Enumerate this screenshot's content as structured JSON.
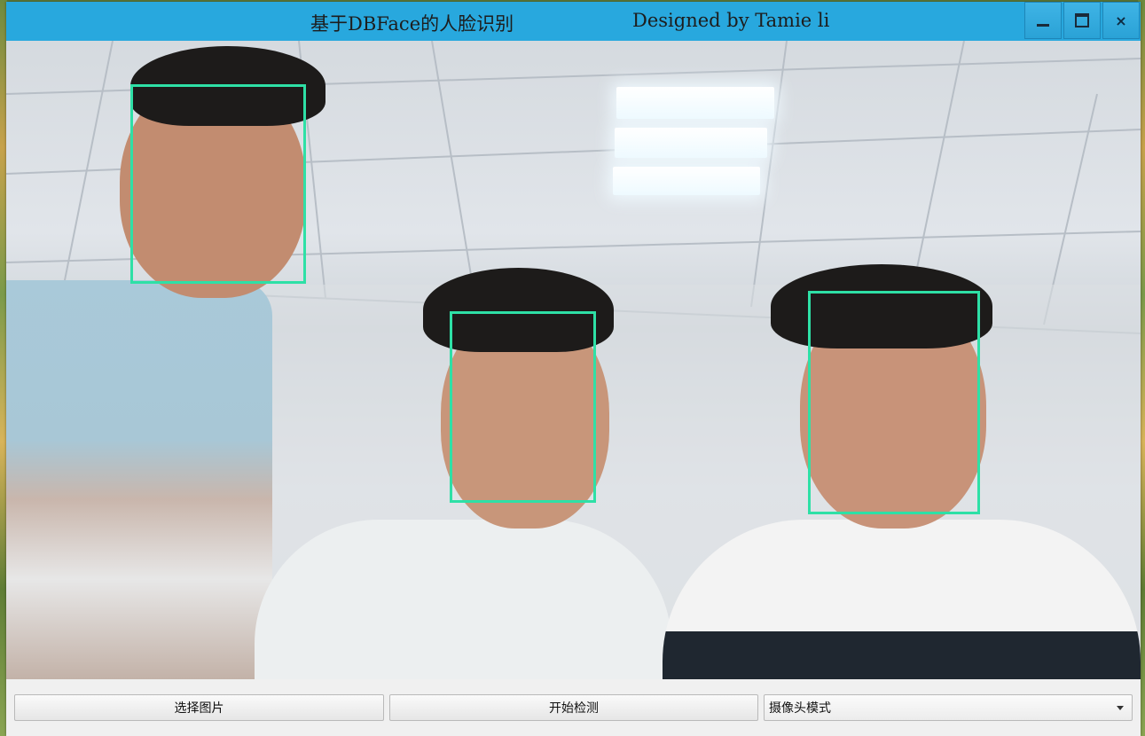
{
  "window": {
    "title": "基于DBFace的人脸识别",
    "credit": "Designed by Tamie li",
    "controls": {
      "minimize": "minimize",
      "maximize": "maximize",
      "close": "×"
    },
    "titlebar_color": "#28a8de"
  },
  "viewport": {
    "detections_color": "#2ee0a6",
    "detected_faces": 3
  },
  "controls": {
    "select_image_label": "选择图片",
    "start_detect_label": "开始检测",
    "mode_select": {
      "selected": "摄像头模式"
    }
  },
  "icons": [
    "minimize-icon",
    "maximize-icon",
    "close-icon",
    "dropdown-arrow-icon"
  ]
}
